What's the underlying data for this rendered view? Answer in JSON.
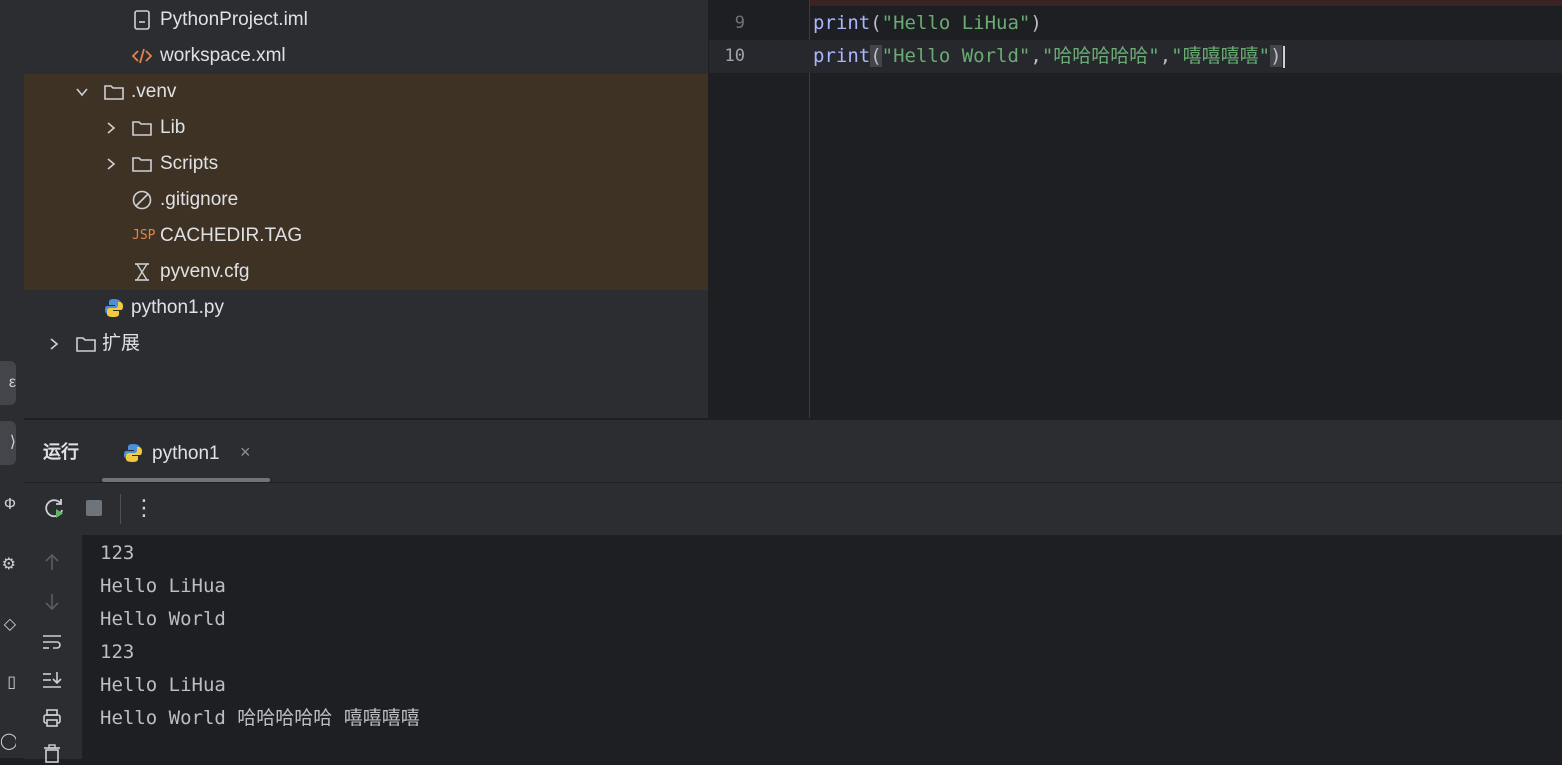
{
  "tree": {
    "items": [
      {
        "label": "PythonProject.iml",
        "icon": "iml-file-icon"
      },
      {
        "label": "workspace.xml",
        "icon": "xml-file-icon"
      },
      {
        "label": ".venv",
        "icon": "folder-icon",
        "expanded": true
      },
      {
        "label": "Lib",
        "icon": "folder-icon",
        "expanded": false
      },
      {
        "label": "Scripts",
        "icon": "folder-icon",
        "expanded": false
      },
      {
        "label": ".gitignore",
        "icon": "ignore-file-icon"
      },
      {
        "label": "CACHEDIR.TAG",
        "icon": "jsp-file-icon",
        "icon_text": "JSP"
      },
      {
        "label": "pyvenv.cfg",
        "icon": "config-file-icon"
      },
      {
        "label": "python1.py",
        "icon": "python-file-icon"
      },
      {
        "label": "扩展",
        "icon": "folder-icon",
        "expanded": false
      }
    ]
  },
  "editor": {
    "lines": [
      {
        "number": "9",
        "fn": "print",
        "open": "(",
        "arg1": "\"Hello LiHua\"",
        "close": ")"
      },
      {
        "number": "10",
        "fn": "print",
        "open": "(",
        "arg1": "\"Hello World\"",
        "sep1": ",",
        "arg2": "\"哈哈哈哈哈\"",
        "sep2": ",",
        "arg3": "\"嘻嘻嘻嘻\"",
        "close": ")"
      }
    ]
  },
  "run_panel": {
    "title": "运行",
    "tab_label": "python1",
    "tab_close": "×",
    "more_label": "⋮",
    "output": [
      "123",
      "Hello LiHua",
      "Hello World",
      "123",
      "Hello LiHua",
      "Hello World 哈哈哈哈哈 嘻嘻嘻嘻"
    ]
  },
  "colors": {
    "keyword": "#a9b7ff",
    "string": "#6aab73",
    "highlight_row": "#3d3223",
    "background": "#1e1f22",
    "panel": "#2b2d30"
  }
}
